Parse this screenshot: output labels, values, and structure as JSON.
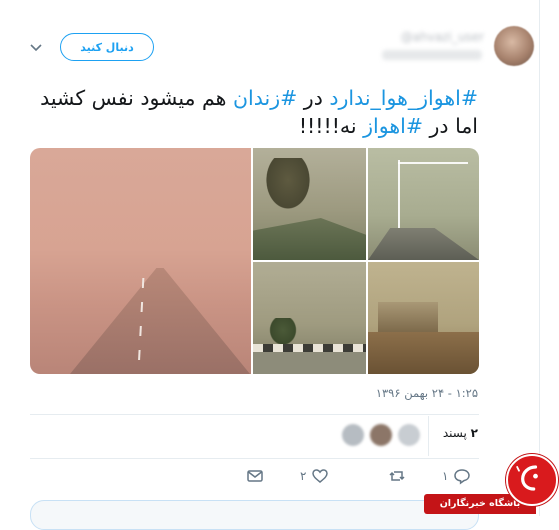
{
  "header": {
    "handle": "@ahvazi_user",
    "follow_label": "دنبال کنید",
    "avatar_icon": "user-avatar",
    "more_icon": "chevron-down-icon"
  },
  "tweet": {
    "tag1": "#اهواز_هوا_ندارد",
    "text1": " در ",
    "tag2": "#زندان",
    "text2": " هم میشود نفس کشید اما در ",
    "tag3": "#اهواز",
    "text3": " نه!!!!!"
  },
  "timestamp": "۱:۲۵ - ۲۴ بهمن ۱۳۹۶",
  "likes": {
    "count": "۲",
    "label": "پسند"
  },
  "actions": {
    "reply_count": "۱",
    "retweet_count": "",
    "like_count": "۲",
    "reply_icon": "reply-icon",
    "retweet_icon": "retweet-icon",
    "like_icon": "heart-icon",
    "dm_icon": "mail-icon"
  },
  "watermark": {
    "label": "باشگاه خبرنگاران",
    "color": "#c41417"
  },
  "colors": {
    "accent": "#1da1f2",
    "hashtag": "#1b95e0",
    "muted": "#657786"
  }
}
